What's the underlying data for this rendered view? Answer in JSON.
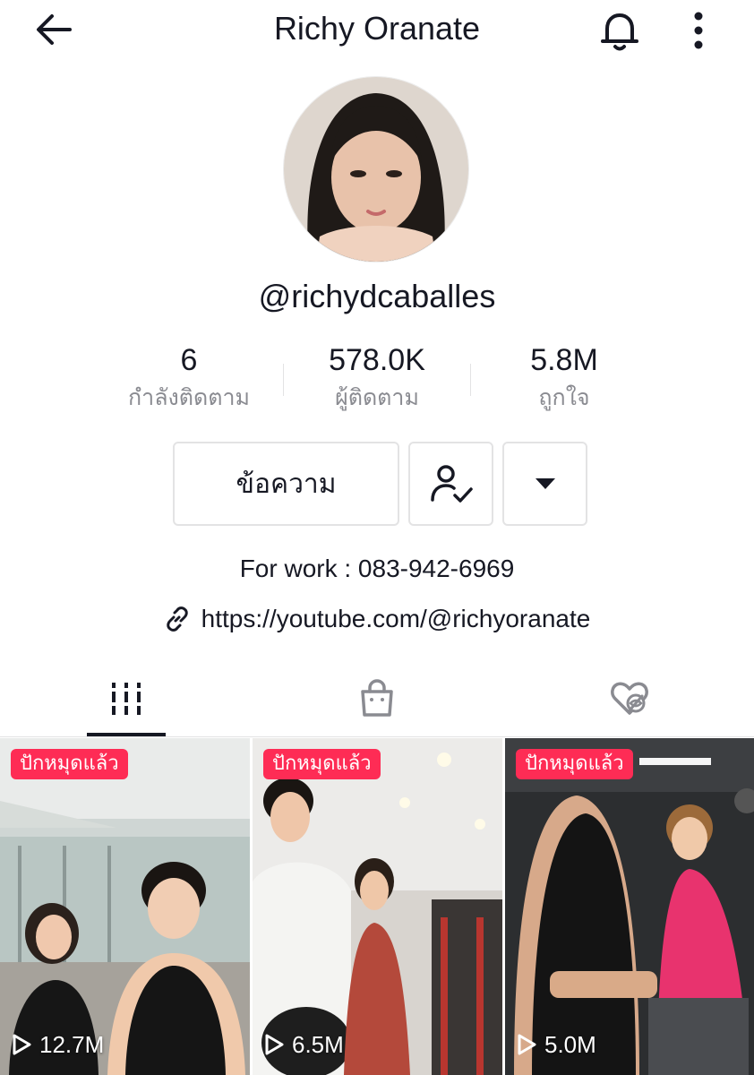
{
  "header": {
    "title": "Richy Oranate"
  },
  "profile": {
    "handle": "@richydcaballes",
    "bio": "For work : 083-942-6969",
    "link": "https://youtube.com/@richyoranate"
  },
  "stats": [
    {
      "value": "6",
      "label": "กำลังติดตาม"
    },
    {
      "value": "578.0K",
      "label": "ผู้ติดตาม"
    },
    {
      "value": "5.8M",
      "label": "ถูกใจ"
    }
  ],
  "actions": {
    "message_label": "ข้อความ"
  },
  "tabs": [
    {
      "icon": "videos-grid-icon",
      "active": true
    },
    {
      "icon": "shop-bag-icon",
      "active": false
    },
    {
      "icon": "liked-hidden-icon",
      "active": false
    }
  ],
  "videos": [
    {
      "badge": "ปักหมุดแล้ว",
      "views": "12.7M"
    },
    {
      "badge": "ปักหมุดแล้ว",
      "views": "6.5M"
    },
    {
      "badge": "ปักหมุดแล้ว",
      "views": "5.0M"
    }
  ],
  "colors": {
    "accent": "#fe2c55",
    "text": "#161823",
    "muted": "#8a8b91",
    "border": "#e3e3e4"
  }
}
